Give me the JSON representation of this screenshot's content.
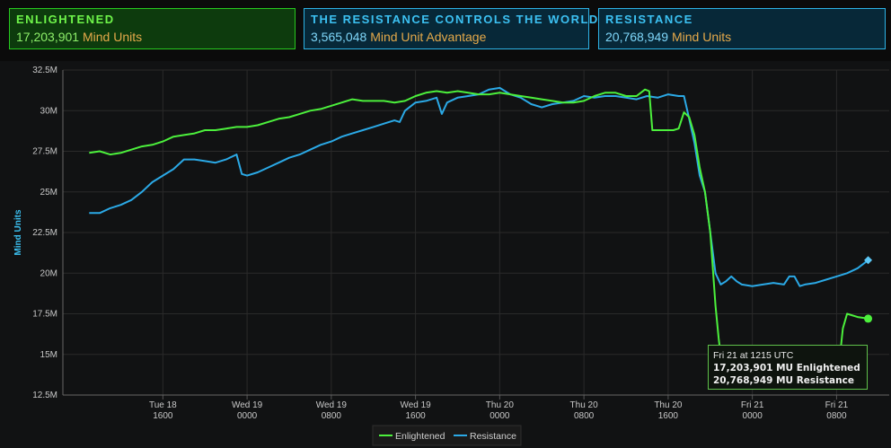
{
  "panels": {
    "enlightened": {
      "title": "ENLIGHTENED",
      "value": "17,203,901",
      "unit": "Mind Units"
    },
    "advantage": {
      "title": "THE RESISTANCE CONTROLS THE WORLD",
      "value": "3,565,048",
      "unit": "Mind Unit Advantage"
    },
    "resistance": {
      "title": "RESISTANCE",
      "value": "20,768,949",
      "unit": "Mind Units"
    }
  },
  "tooltip": {
    "time": "Fri 21 at 1215 UTC",
    "enl_value": "17,203,901",
    "enl_label": "MU Enlightened",
    "res_value": "20,768,949",
    "res_label": "MU Resistance"
  },
  "colors": {
    "enlightened": "#4cf03c",
    "resistance": "#2ba9e6",
    "grid": "#2a2a2a"
  },
  "chart_data": {
    "type": "line",
    "xlabel": "",
    "ylabel": "Mind Units",
    "ylim": [
      12.5,
      32.5
    ],
    "yticks": [
      "12.5M",
      "15M",
      "17.5M",
      "20M",
      "22.5M",
      "25M",
      "27.5M",
      "30M",
      "32.5M"
    ],
    "yticks_values": [
      12.5,
      15,
      17.5,
      20,
      22.5,
      25,
      27.5,
      30,
      32.5
    ],
    "xticks": [
      {
        "t": 16,
        "day": "Tue 18",
        "time": "1600"
      },
      {
        "t": 24,
        "day": "Wed 19",
        "time": "0000"
      },
      {
        "t": 32,
        "day": "Wed 19",
        "time": "0800"
      },
      {
        "t": 40,
        "day": "Wed 19",
        "time": "1600"
      },
      {
        "t": 48,
        "day": "Thu 20",
        "time": "0000"
      },
      {
        "t": 56,
        "day": "Thu 20",
        "time": "0800"
      },
      {
        "t": 64,
        "day": "Thu 20",
        "time": "1600"
      },
      {
        "t": 72,
        "day": "Fri 21",
        "time": "0000"
      },
      {
        "t": 80,
        "day": "Fri 21",
        "time": "0800"
      }
    ],
    "grid": true,
    "legend_position": "bottom-center",
    "series": [
      {
        "name": "Enlightened",
        "points": [
          [
            9.0,
            27.4
          ],
          [
            10.0,
            27.5
          ],
          [
            11.0,
            27.3
          ],
          [
            12.0,
            27.4
          ],
          [
            13.0,
            27.6
          ],
          [
            14.0,
            27.8
          ],
          [
            15.0,
            27.9
          ],
          [
            16.0,
            28.1
          ],
          [
            17.0,
            28.4
          ],
          [
            18.0,
            28.5
          ],
          [
            19.0,
            28.6
          ],
          [
            20.0,
            28.8
          ],
          [
            21.0,
            28.8
          ],
          [
            22.0,
            28.9
          ],
          [
            23.0,
            29.0
          ],
          [
            24.0,
            29.0
          ],
          [
            25.0,
            29.1
          ],
          [
            26.0,
            29.3
          ],
          [
            27.0,
            29.5
          ],
          [
            28.0,
            29.6
          ],
          [
            29.0,
            29.8
          ],
          [
            30.0,
            30.0
          ],
          [
            31.0,
            30.1
          ],
          [
            32.0,
            30.3
          ],
          [
            33.0,
            30.5
          ],
          [
            34.0,
            30.7
          ],
          [
            35.0,
            30.6
          ],
          [
            36.0,
            30.6
          ],
          [
            37.0,
            30.6
          ],
          [
            38.0,
            30.5
          ],
          [
            39.0,
            30.6
          ],
          [
            40.0,
            30.9
          ],
          [
            41.0,
            31.1
          ],
          [
            42.0,
            31.2
          ],
          [
            43.0,
            31.1
          ],
          [
            44.0,
            31.2
          ],
          [
            45.0,
            31.1
          ],
          [
            46.0,
            31.0
          ],
          [
            47.0,
            31.0
          ],
          [
            48.0,
            31.1
          ],
          [
            49.0,
            31.0
          ],
          [
            50.0,
            30.9
          ],
          [
            51.0,
            30.8
          ],
          [
            52.0,
            30.7
          ],
          [
            53.0,
            30.6
          ],
          [
            54.0,
            30.5
          ],
          [
            55.0,
            30.5
          ],
          [
            56.0,
            30.6
          ],
          [
            57.0,
            30.9
          ],
          [
            58.0,
            31.1
          ],
          [
            59.0,
            31.1
          ],
          [
            60.0,
            30.9
          ],
          [
            61.0,
            30.9
          ],
          [
            61.8,
            31.3
          ],
          [
            62.2,
            31.2
          ],
          [
            62.5,
            28.8
          ],
          [
            63.5,
            28.8
          ],
          [
            64.5,
            28.8
          ],
          [
            65.0,
            28.9
          ],
          [
            65.5,
            29.9
          ],
          [
            66.0,
            29.6
          ],
          [
            66.5,
            28.5
          ],
          [
            67.0,
            26.5
          ],
          [
            67.5,
            25.0
          ],
          [
            68.0,
            22.5
          ],
          [
            68.5,
            18.0
          ],
          [
            68.8,
            16.0
          ],
          [
            69.0,
            14.9
          ],
          [
            69.5,
            14.6
          ],
          [
            70.0,
            14.6
          ],
          [
            70.5,
            14.8
          ],
          [
            71.0,
            14.4
          ],
          [
            72.0,
            14.3
          ],
          [
            73.0,
            14.4
          ],
          [
            74.0,
            14.5
          ],
          [
            75.0,
            14.6
          ],
          [
            76.0,
            14.7
          ],
          [
            77.0,
            15.0
          ],
          [
            78.0,
            15.2
          ],
          [
            79.0,
            15.4
          ],
          [
            80.0,
            15.5
          ],
          [
            80.4,
            15.4
          ],
          [
            80.6,
            16.6
          ],
          [
            81.0,
            17.5
          ],
          [
            82.0,
            17.3
          ],
          [
            83.0,
            17.2
          ]
        ]
      },
      {
        "name": "Resistance",
        "points": [
          [
            9.0,
            23.7
          ],
          [
            10.0,
            23.7
          ],
          [
            11.0,
            24.0
          ],
          [
            12.0,
            24.2
          ],
          [
            13.0,
            24.5
          ],
          [
            14.0,
            25.0
          ],
          [
            15.0,
            25.6
          ],
          [
            16.0,
            26.0
          ],
          [
            17.0,
            26.4
          ],
          [
            18.0,
            27.0
          ],
          [
            19.0,
            27.0
          ],
          [
            20.0,
            26.9
          ],
          [
            21.0,
            26.8
          ],
          [
            22.0,
            27.0
          ],
          [
            23.0,
            27.3
          ],
          [
            23.5,
            26.1
          ],
          [
            24.0,
            26.0
          ],
          [
            25.0,
            26.2
          ],
          [
            26.0,
            26.5
          ],
          [
            27.0,
            26.8
          ],
          [
            28.0,
            27.1
          ],
          [
            29.0,
            27.3
          ],
          [
            30.0,
            27.6
          ],
          [
            31.0,
            27.9
          ],
          [
            32.0,
            28.1
          ],
          [
            33.0,
            28.4
          ],
          [
            34.0,
            28.6
          ],
          [
            35.0,
            28.8
          ],
          [
            36.0,
            29.0
          ],
          [
            37.0,
            29.2
          ],
          [
            38.0,
            29.4
          ],
          [
            38.5,
            29.3
          ],
          [
            39.0,
            30.0
          ],
          [
            40.0,
            30.5
          ],
          [
            41.0,
            30.6
          ],
          [
            42.0,
            30.8
          ],
          [
            42.5,
            29.8
          ],
          [
            43.0,
            30.5
          ],
          [
            44.0,
            30.8
          ],
          [
            45.0,
            30.9
          ],
          [
            46.0,
            31.0
          ],
          [
            47.0,
            31.3
          ],
          [
            48.0,
            31.4
          ],
          [
            49.0,
            31.0
          ],
          [
            50.0,
            30.8
          ],
          [
            51.0,
            30.4
          ],
          [
            52.0,
            30.2
          ],
          [
            53.0,
            30.4
          ],
          [
            54.0,
            30.5
          ],
          [
            55.0,
            30.6
          ],
          [
            56.0,
            30.9
          ],
          [
            57.0,
            30.8
          ],
          [
            58.0,
            30.9
          ],
          [
            59.0,
            30.9
          ],
          [
            60.0,
            30.8
          ],
          [
            61.0,
            30.7
          ],
          [
            62.0,
            30.9
          ],
          [
            63.0,
            30.8
          ],
          [
            64.0,
            31.0
          ],
          [
            65.0,
            30.9
          ],
          [
            65.5,
            30.9
          ],
          [
            66.0,
            29.5
          ],
          [
            66.5,
            28.0
          ],
          [
            67.0,
            26.0
          ],
          [
            67.5,
            25.0
          ],
          [
            68.0,
            22.5
          ],
          [
            68.5,
            20.0
          ],
          [
            69.0,
            19.3
          ],
          [
            69.5,
            19.5
          ],
          [
            70.0,
            19.8
          ],
          [
            70.5,
            19.5
          ],
          [
            71.0,
            19.3
          ],
          [
            72.0,
            19.2
          ],
          [
            73.0,
            19.3
          ],
          [
            74.0,
            19.4
          ],
          [
            75.0,
            19.3
          ],
          [
            75.5,
            19.8
          ],
          [
            76.0,
            19.8
          ],
          [
            76.5,
            19.2
          ],
          [
            77.0,
            19.3
          ],
          [
            78.0,
            19.4
          ],
          [
            79.0,
            19.6
          ],
          [
            80.0,
            19.8
          ],
          [
            81.0,
            20.0
          ],
          [
            82.0,
            20.3
          ],
          [
            83.0,
            20.8
          ]
        ]
      }
    ],
    "highlight": {
      "t": 83.0,
      "enlightened": 17.2,
      "resistance": 20.8
    }
  },
  "legend": {
    "enlightened": "Enlightened",
    "resistance": "Resistance"
  }
}
